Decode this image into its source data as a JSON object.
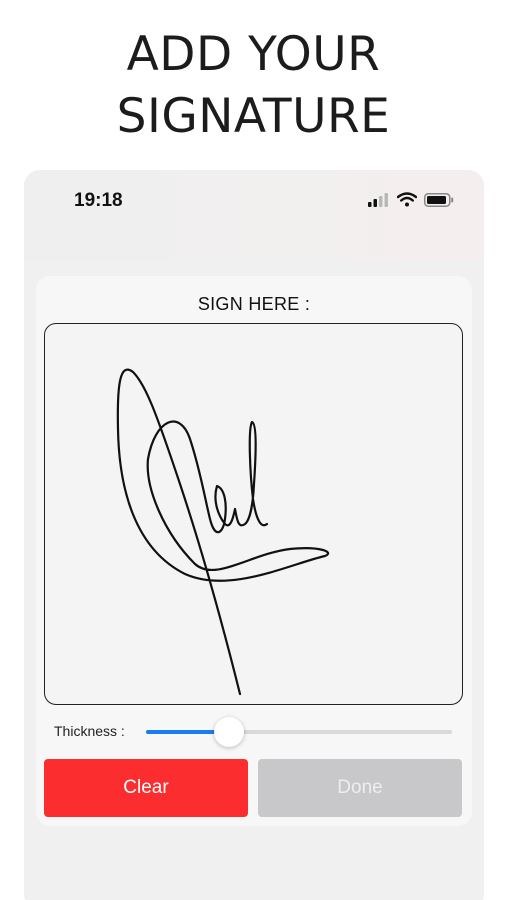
{
  "header": {
    "line1": "ADD YOUR",
    "line2": "SIGNATURE"
  },
  "statusbar": {
    "time": "19:18",
    "icons": [
      "cellular-signal-icon",
      "wifi-icon",
      "battery-icon"
    ]
  },
  "signature_panel": {
    "label": "SIGN HERE :",
    "thickness_label": "Thickness :",
    "thickness_value": 0.27,
    "clear_label": "Clear",
    "done_label": "Done"
  },
  "colors": {
    "clear": "#fb2d2e",
    "done_disabled": "#c8c8ca",
    "slider_fill": "#1a7cf5"
  }
}
